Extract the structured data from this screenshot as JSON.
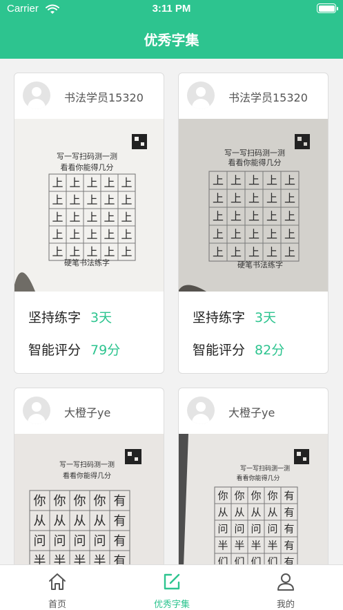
{
  "status_bar": {
    "carrier": "Carrier",
    "time": "3:11 PM"
  },
  "header": {
    "title": "优秀字集"
  },
  "cards": [
    {
      "username": "书法学员15320",
      "days_label": "坚持练字",
      "days_value": "3天",
      "score_label": "智能评分",
      "score_value": "79分",
      "sheet_title_1": "写一写扫码测一测",
      "sheet_title_2": "看看你能得几分",
      "sheet_footer": "硬笔书法练字",
      "grid_char": "上"
    },
    {
      "username": "书法学员15320",
      "days_label": "坚持练字",
      "days_value": "3天",
      "score_label": "智能评分",
      "score_value": "82分",
      "sheet_title_1": "写一写扫码测一测",
      "sheet_title_2": "看看你能得几分",
      "sheet_footer": "硬笔书法练字",
      "grid_char": "上"
    },
    {
      "username": "大橙子ye",
      "sheet_title_1": "写一写扫码测一测",
      "sheet_title_2": "看看你能得几分",
      "grid_rows": [
        "你你你你有",
        "从从从从有",
        "问问问问有",
        "半半半半有"
      ]
    },
    {
      "username": "大橙子ye",
      "sheet_title_1": "写一写扫码测一测",
      "sheet_title_2": "看看你能得几分",
      "grid_rows": [
        "你你你你有",
        "从从从从有",
        "问问问问有",
        "半半半半有",
        "们们们们有"
      ]
    }
  ],
  "tabbar": [
    {
      "label": "首页",
      "icon": "home-icon",
      "active": false
    },
    {
      "label": "优秀字集",
      "icon": "edit-icon",
      "active": true
    },
    {
      "label": "我的",
      "icon": "profile-icon",
      "active": false
    }
  ],
  "colors": {
    "accent": "#2dc48f",
    "text": "#222222",
    "background": "#f2f2f2"
  }
}
